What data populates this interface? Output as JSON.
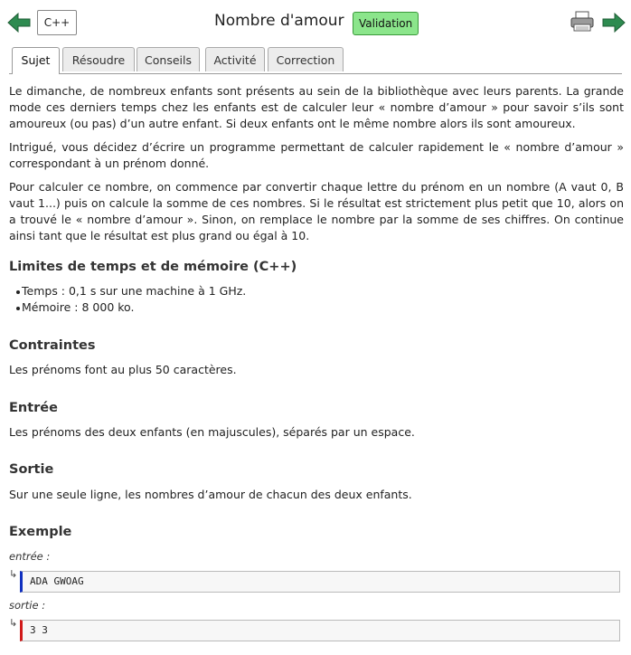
{
  "header": {
    "language": "C++",
    "title": "Nombre d'amour",
    "validation": "Validation",
    "icons": {
      "prev": "left-arrow-icon",
      "next": "right-arrow-icon",
      "print": "printer-icon"
    },
    "colors": {
      "arrow": "#2e8b50",
      "validation_bg": "#8be58b"
    }
  },
  "tabs": [
    {
      "label": "Sujet",
      "active": true
    },
    {
      "label": "Résoudre",
      "active": false
    },
    {
      "label": "Conseils",
      "active": false
    },
    {
      "label": "Activité",
      "active": false
    },
    {
      "label": "Correction",
      "active": false
    }
  ],
  "statement": {
    "paragraphs": [
      "Le dimanche, de nombreux enfants sont présents au sein de la bibliothèque avec leurs parents. La grande mode ces derniers temps chez les enfants est de calculer leur « nombre d’amour » pour savoir s’ils sont amoureux (ou pas) d’un autre enfant. Si deux enfants ont le même nombre alors ils sont amoureux.",
      "Intrigué, vous décidez d’écrire un programme permettant de calculer rapidement le « nombre d’amour » correspondant à un prénom donné.",
      "Pour calculer ce nombre, on commence par convertir chaque lettre du prénom en un nombre (A vaut 0, B vaut 1...) puis on calcule la somme de ces nombres. Si le résultat est strictement plus petit que 10, alors on a trouvé le « nombre d’amour ». Sinon, on remplace le nombre par la somme de ses chiffres. On continue ainsi tant que le résultat est plus grand ou égal à 10."
    ]
  },
  "limits": {
    "heading": "Limites de temps et de mémoire (C++)",
    "items": [
      "Temps : 0,1 s sur une machine à 1 GHz.",
      "Mémoire : 8 000 ko."
    ]
  },
  "constraints": {
    "heading": "Contraintes",
    "text": "Les prénoms font au plus 50 caractères."
  },
  "input": {
    "heading": "Entrée",
    "text": "Les prénoms des deux enfants (en majuscules), séparés par un espace."
  },
  "output": {
    "heading": "Sortie",
    "text": "Sur une seule ligne, les nombres d’amour de chacun des deux enfants."
  },
  "example": {
    "heading": "Exemple",
    "input_label": "entrée :",
    "input_value": "ADA GWOAG",
    "output_label": "sortie :",
    "output_value": "3 3",
    "hook": "↳"
  }
}
